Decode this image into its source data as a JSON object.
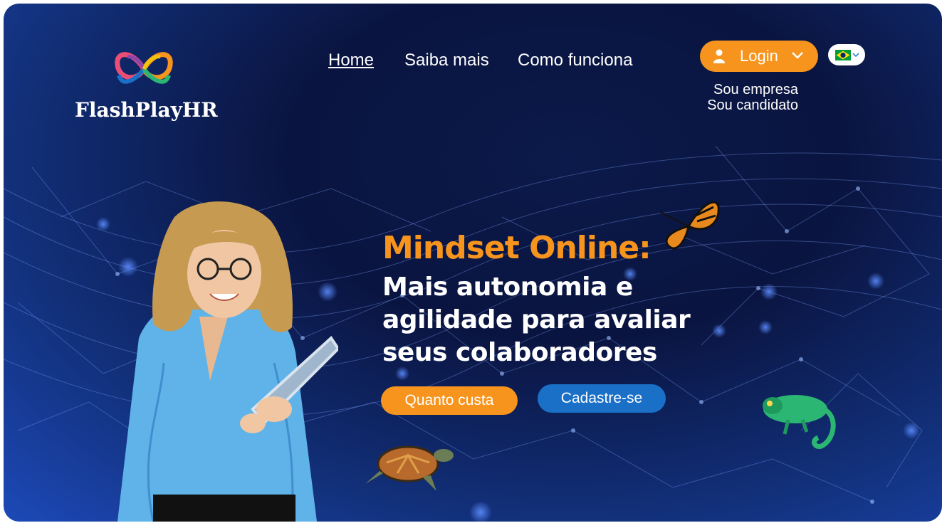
{
  "brand": {
    "name": "FlashPlayHR"
  },
  "nav": {
    "home": "Home",
    "saiba_mais": "Saiba mais",
    "como_funciona": "Como funciona"
  },
  "login": {
    "label": "Login",
    "options": [
      "Sou empresa",
      "Sou candidato"
    ]
  },
  "language": {
    "icon": "brazil-flag-icon"
  },
  "hero": {
    "title": "Mindset Online:",
    "subtitle_lines": [
      "Mais autonomia e",
      "agilidade para avaliar",
      "seus colaboradores"
    ],
    "cta_primary": "Quanto custa",
    "cta_secondary": "Cadastre-se"
  },
  "colors": {
    "accent_orange": "#f7941d",
    "accent_blue": "#1a6fc7",
    "background_dark": "#0a1440"
  },
  "icons": [
    "user-icon",
    "chevron-down-icon",
    "brazil-flag-icon",
    "logo-icon",
    "butterfly-icon",
    "turtle-icon",
    "chameleon-icon"
  ]
}
